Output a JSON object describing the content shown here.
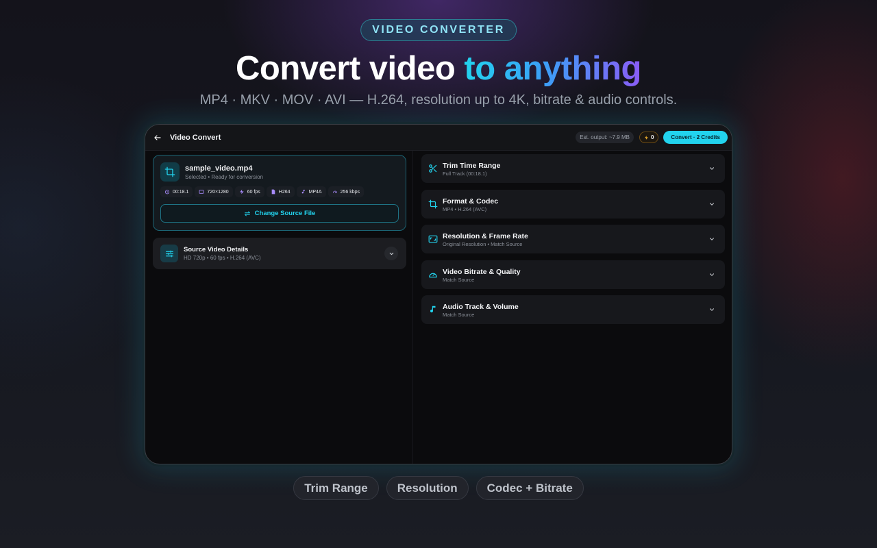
{
  "header": {
    "badge": "VIDEO CONVERTER",
    "headline_main": "Convert video",
    "headline_accent": "to anything",
    "subtitle": "MP4 · MKV · MOV · AVI — H.264, resolution up to 4K, bitrate & audio controls."
  },
  "app": {
    "title": "Video Convert",
    "est_output": "Est. output: ~7.9 MB",
    "credits": "0",
    "convert_label": "Convert · 2 Credits"
  },
  "source": {
    "file_name": "sample_video.mp4",
    "status": "Selected • Ready for conversion",
    "chips": [
      {
        "icon": "timer-icon",
        "label": "00:18.1"
      },
      {
        "icon": "aspect-ratio-icon",
        "label": "720×1280"
      },
      {
        "icon": "bolt-icon",
        "label": "60 fps"
      },
      {
        "icon": "file-video-icon",
        "label": "H264"
      },
      {
        "icon": "music-note-icon",
        "label": "MP4A"
      },
      {
        "icon": "gauge-icon",
        "label": "256 kbps"
      }
    ],
    "change_button": "Change Source File"
  },
  "details": {
    "title": "Source Video Details",
    "subtitle": "HD 720p • 60 fps • H.264 (AVC)"
  },
  "sections": [
    {
      "title": "Trim Time Range",
      "subtitle": "Full Track (00:18.1)",
      "icon": "scissors-icon"
    },
    {
      "title": "Format & Codec",
      "subtitle": "MP4 • H.264 (AVC)",
      "icon": "crop-icon"
    },
    {
      "title": "Resolution & Frame Rate",
      "subtitle": "Original Resolution • Match Source",
      "icon": "aspect-ratio-icon"
    },
    {
      "title": "Video Bitrate & Quality",
      "subtitle": "Match Source",
      "icon": "speedometer-icon"
    },
    {
      "title": "Audio Track & Volume",
      "subtitle": "Match Source",
      "icon": "music-note-icon"
    }
  ],
  "pills": [
    "Trim Range",
    "Resolution",
    "Codec + Bitrate"
  ],
  "colors": {
    "accent": "#22d3ee",
    "accent_gradient_end": "#8a5cf6",
    "background": "#0b0b0d",
    "card": "#17181c",
    "chip_icon": "#a78bfa"
  }
}
